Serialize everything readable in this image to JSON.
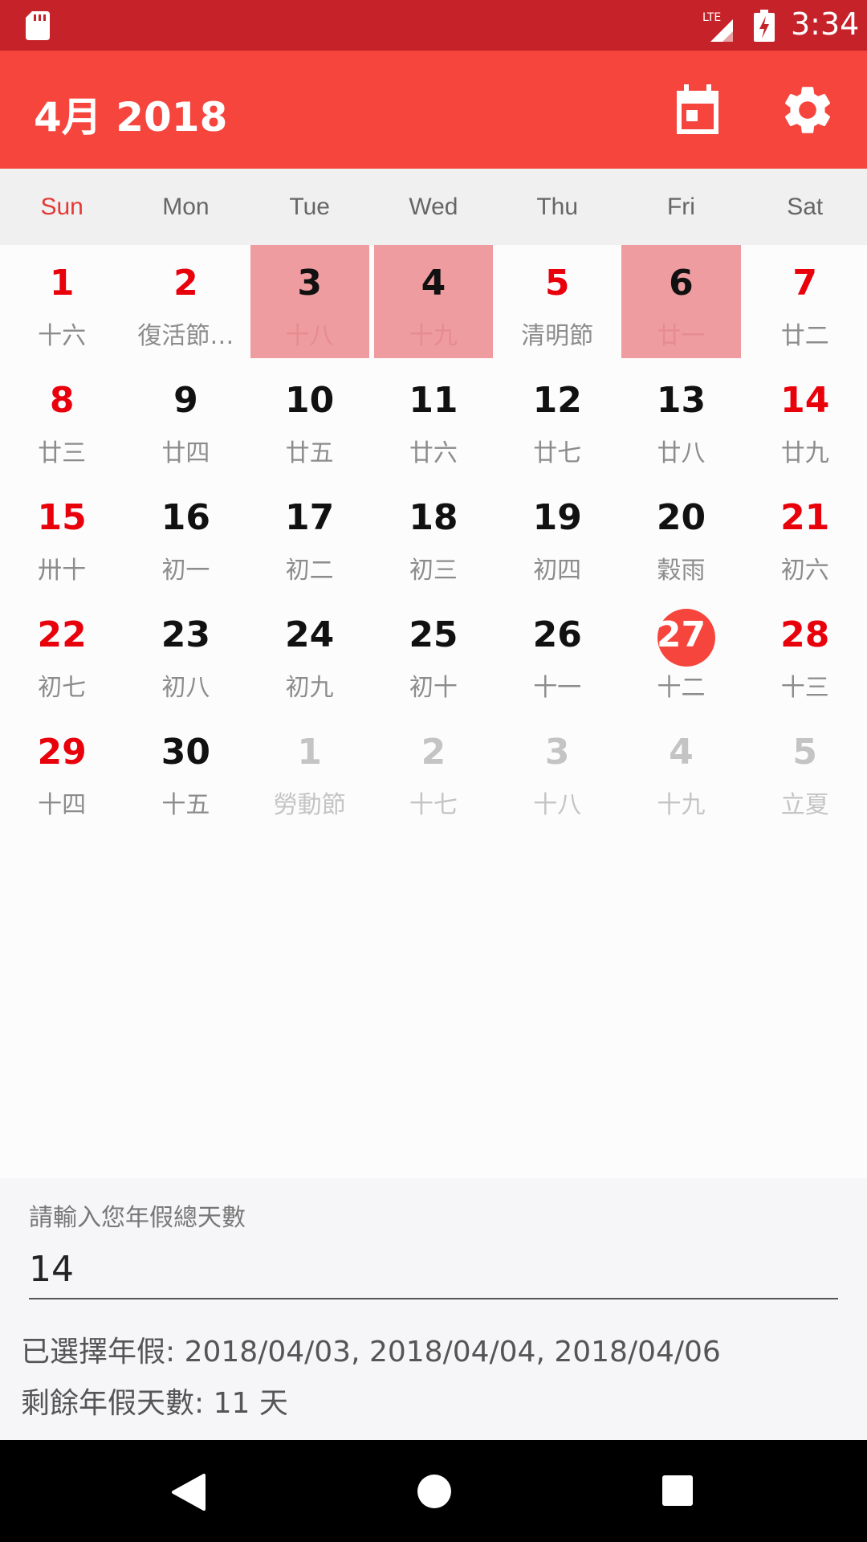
{
  "status_bar": {
    "network": "LTE",
    "time": "3:34"
  },
  "app_bar": {
    "title": "4月 2018",
    "today_icon": "calendar-today-icon",
    "settings_icon": "gear-icon"
  },
  "calendar": {
    "weekdays": [
      "Sun",
      "Mon",
      "Tue",
      "Wed",
      "Thu",
      "Fri",
      "Sat"
    ],
    "days": [
      {
        "day": "1",
        "lunar": "十六",
        "red": true
      },
      {
        "day": "2",
        "lunar": "復活節…",
        "red": true
      },
      {
        "day": "3",
        "lunar": "十八",
        "selected": true
      },
      {
        "day": "4",
        "lunar": "十九",
        "selected": true
      },
      {
        "day": "5",
        "lunar": "清明節",
        "red": true
      },
      {
        "day": "6",
        "lunar": "廿一",
        "selected": true
      },
      {
        "day": "7",
        "lunar": "廿二",
        "red": true
      },
      {
        "day": "8",
        "lunar": "廿三",
        "red": true
      },
      {
        "day": "9",
        "lunar": "廿四"
      },
      {
        "day": "10",
        "lunar": "廿五"
      },
      {
        "day": "11",
        "lunar": "廿六"
      },
      {
        "day": "12",
        "lunar": "廿七"
      },
      {
        "day": "13",
        "lunar": "廿八"
      },
      {
        "day": "14",
        "lunar": "廿九",
        "red": true
      },
      {
        "day": "15",
        "lunar": "卅十",
        "red": true
      },
      {
        "day": "16",
        "lunar": "初一"
      },
      {
        "day": "17",
        "lunar": "初二"
      },
      {
        "day": "18",
        "lunar": "初三"
      },
      {
        "day": "19",
        "lunar": "初四"
      },
      {
        "day": "20",
        "lunar": "穀雨"
      },
      {
        "day": "21",
        "lunar": "初六",
        "red": true
      },
      {
        "day": "22",
        "lunar": "初七",
        "red": true
      },
      {
        "day": "23",
        "lunar": "初八"
      },
      {
        "day": "24",
        "lunar": "初九"
      },
      {
        "day": "25",
        "lunar": "初十"
      },
      {
        "day": "26",
        "lunar": "十一"
      },
      {
        "day": "27",
        "lunar": "十二",
        "today": true
      },
      {
        "day": "28",
        "lunar": "十三",
        "red": true
      },
      {
        "day": "29",
        "lunar": "十四",
        "red": true
      },
      {
        "day": "30",
        "lunar": "十五"
      },
      {
        "day": "1",
        "lunar": "勞動節",
        "other_month": true
      },
      {
        "day": "2",
        "lunar": "十七",
        "other_month": true
      },
      {
        "day": "3",
        "lunar": "十八",
        "other_month": true
      },
      {
        "day": "4",
        "lunar": "十九",
        "other_month": true
      },
      {
        "day": "5",
        "lunar": "立夏",
        "other_month": true
      }
    ]
  },
  "leave_panel": {
    "input_label": "請輸入您年假總天數",
    "input_value": "14",
    "selected_text": "已選擇年假: 2018/04/03, 2018/04/04, 2018/04/06",
    "remaining_text": "剩餘年假天數: 11 天"
  },
  "colors": {
    "status_bar": "#c62229",
    "app_bar": "#f5453d",
    "holiday_red": "#e8000b",
    "selected_bg": "#ef9ca0"
  }
}
